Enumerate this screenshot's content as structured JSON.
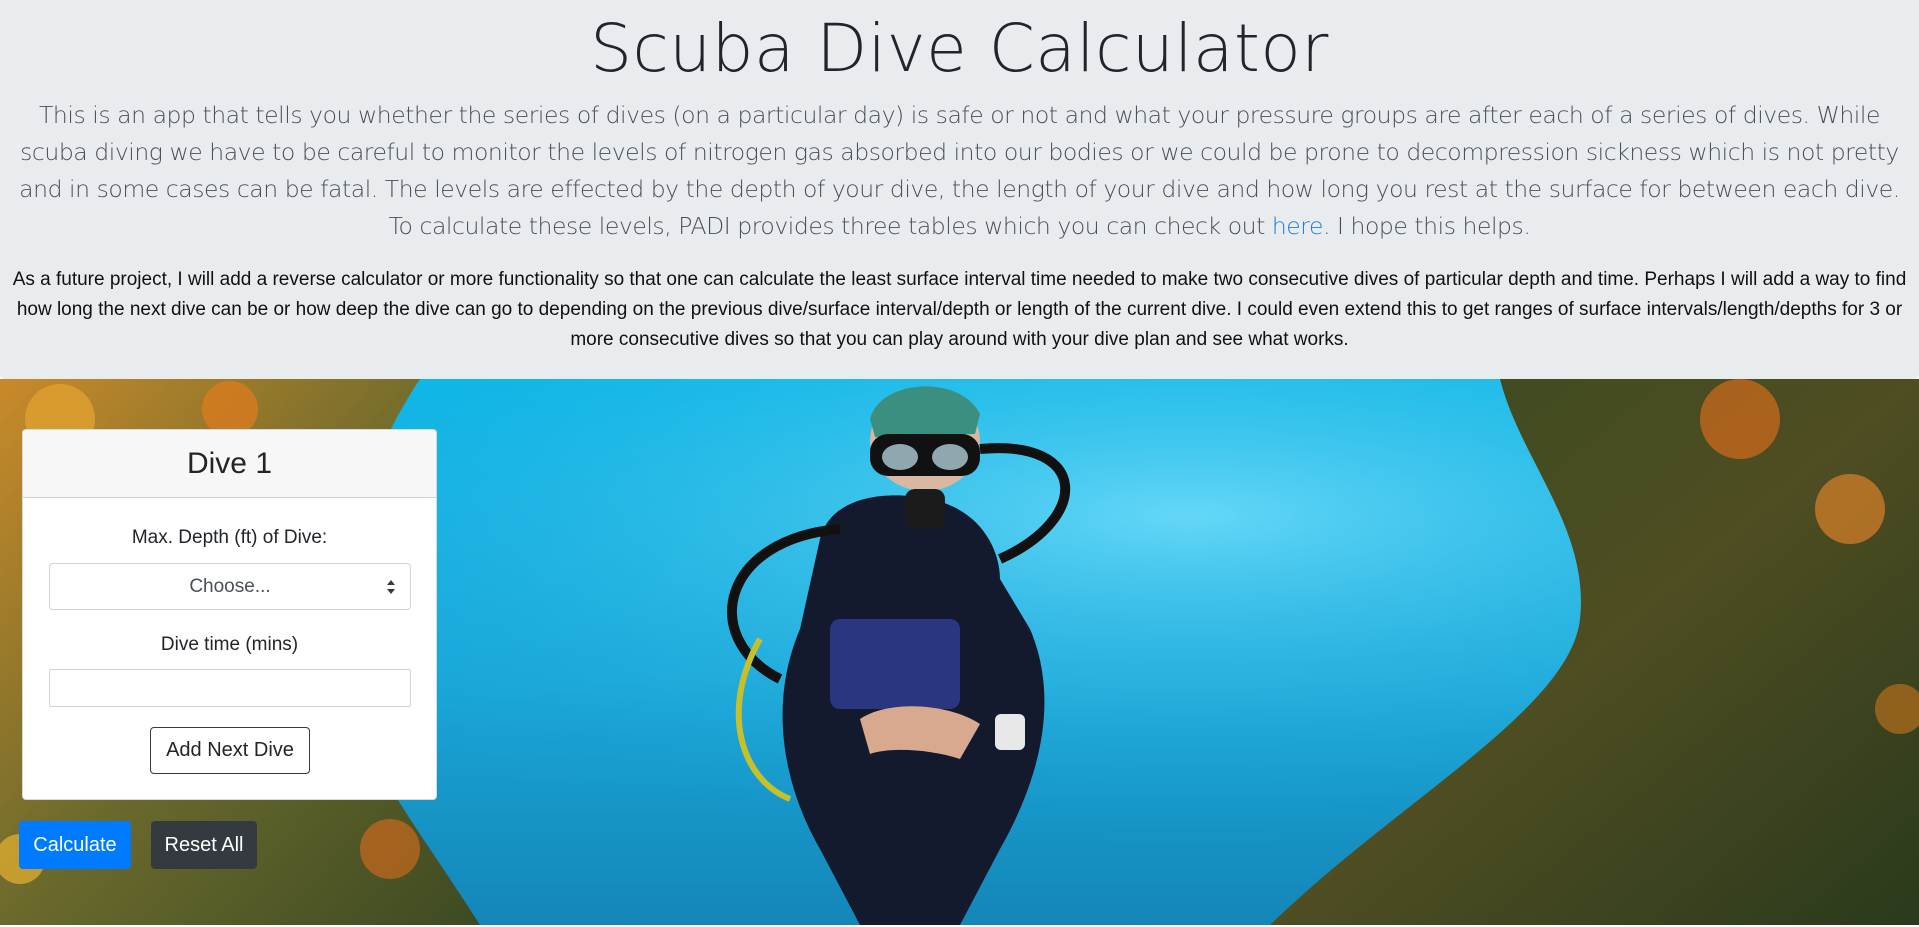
{
  "header": {
    "title": "Scuba Dive Calculator",
    "intro_before_link": "This is an app that tells you whether the series of dives (on a particular day) is safe or not and what your pressure groups are after each of a series of dives. While scuba diving we have to be careful to monitor the levels of nitrogen gas absorbed into our bodies or we could be prone to decompression sickness which is not pretty and in some cases can be fatal. The levels are effected by the depth of your dive, the length of your dive and how long you rest at the surface for between each dive. To calculate these levels, PADI provides three tables which you can check out ",
    "intro_link": "here",
    "intro_after_link": ". I hope this helps.",
    "future_project": "As a future project, I will add a reverse calculator or more functionality so that one can calculate the least surface interval time needed to make two consecutive dives of particular depth and time. Perhaps I will add a way to find how long the next dive can be or how deep the dive can go to depending on the previous dive/surface interval/depth or length of the current dive. I could even extend this to get ranges of surface intervals/length/depths for 3 or more consecutive dives so that you can play around with your dive plan and see what works."
  },
  "dive_card": {
    "title": "Dive 1",
    "depth_label": "Max. Depth (ft) of Dive:",
    "depth_selected": "Choose...",
    "time_label": "Dive time (mins)",
    "time_value": "",
    "add_button": "Add Next Dive"
  },
  "actions": {
    "calculate": "Calculate",
    "reset": "Reset All"
  },
  "colors": {
    "jumbotron_bg": "#e9ecef",
    "link": "#1a7fd6",
    "primary": "#007bff",
    "dark": "#343a40",
    "water": "#0bb7e8"
  }
}
